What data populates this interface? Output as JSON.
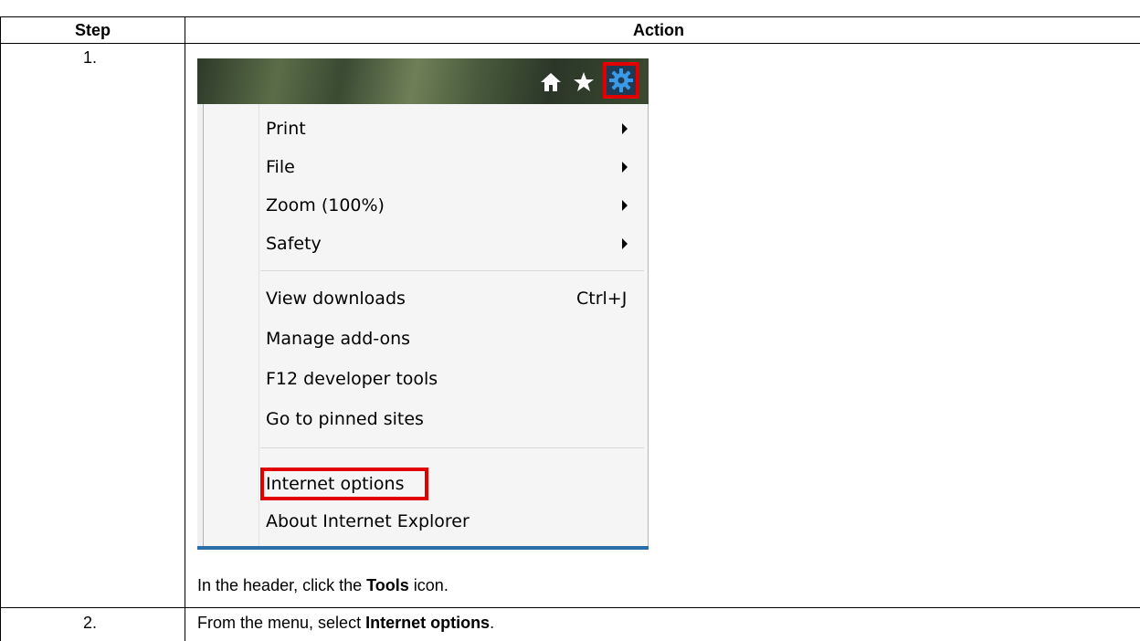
{
  "table": {
    "headers": {
      "step": "Step",
      "action": "Action"
    },
    "rows": [
      {
        "step": "1.",
        "text_before": "In the header, click the ",
        "bold": "Tools",
        "text_after": " icon."
      },
      {
        "step": "2.",
        "text_before": "From the menu, select ",
        "bold": "Internet options",
        "text_after": "."
      }
    ]
  },
  "screenshot": {
    "icons": [
      "home-icon",
      "star-icon",
      "gear-icon"
    ],
    "menu_items": [
      {
        "label": "Print",
        "submenu": true
      },
      {
        "label": "File",
        "submenu": true
      },
      {
        "label": "Zoom (100%)",
        "submenu": true
      },
      {
        "label": "Safety",
        "submenu": true
      },
      {
        "label": "View downloads",
        "shortcut": "Ctrl+J"
      },
      {
        "label": "Manage add-ons"
      },
      {
        "label": "F12 developer tools"
      },
      {
        "label": "Go to pinned sites"
      },
      {
        "label": "Internet options"
      },
      {
        "label": "About Internet Explorer"
      }
    ],
    "highlight_color": "#e00000"
  }
}
